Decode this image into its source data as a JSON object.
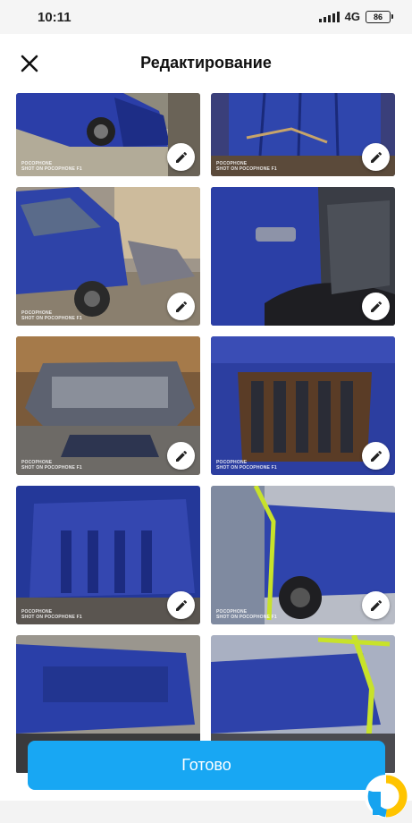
{
  "status_bar": {
    "time": "10:11",
    "network": "4G",
    "battery": "86"
  },
  "header": {
    "title": "Редактирование"
  },
  "photos": [
    {
      "watermark": "POCOPHONE\nSHOT ON POCOPHONE F1"
    },
    {
      "watermark": "POCOPHONE\nSHOT ON POCOPHONE F1"
    },
    {
      "watermark": "POCOPHONE\nSHOT ON POCOPHONE F1"
    },
    {
      "watermark": ""
    },
    {
      "watermark": "POCOPHONE\nSHOT ON POCOPHONE F1"
    },
    {
      "watermark": "POCOPHONE\nSHOT ON POCOPHONE F1"
    },
    {
      "watermark": "POCOPHONE\nSHOT ON POCOPHONE F1"
    },
    {
      "watermark": "POCOPHONE\nSHOT ON POCOPHONE F1"
    },
    {
      "watermark": ""
    },
    {
      "watermark": ""
    }
  ],
  "actions": {
    "done_label": "Готово"
  },
  "colors": {
    "accent": "#18a7f3",
    "car_blue": "#2a3f9e"
  },
  "icons": {
    "close": "close-icon",
    "edit": "pencil-icon",
    "logo": "app-logo-icon"
  }
}
